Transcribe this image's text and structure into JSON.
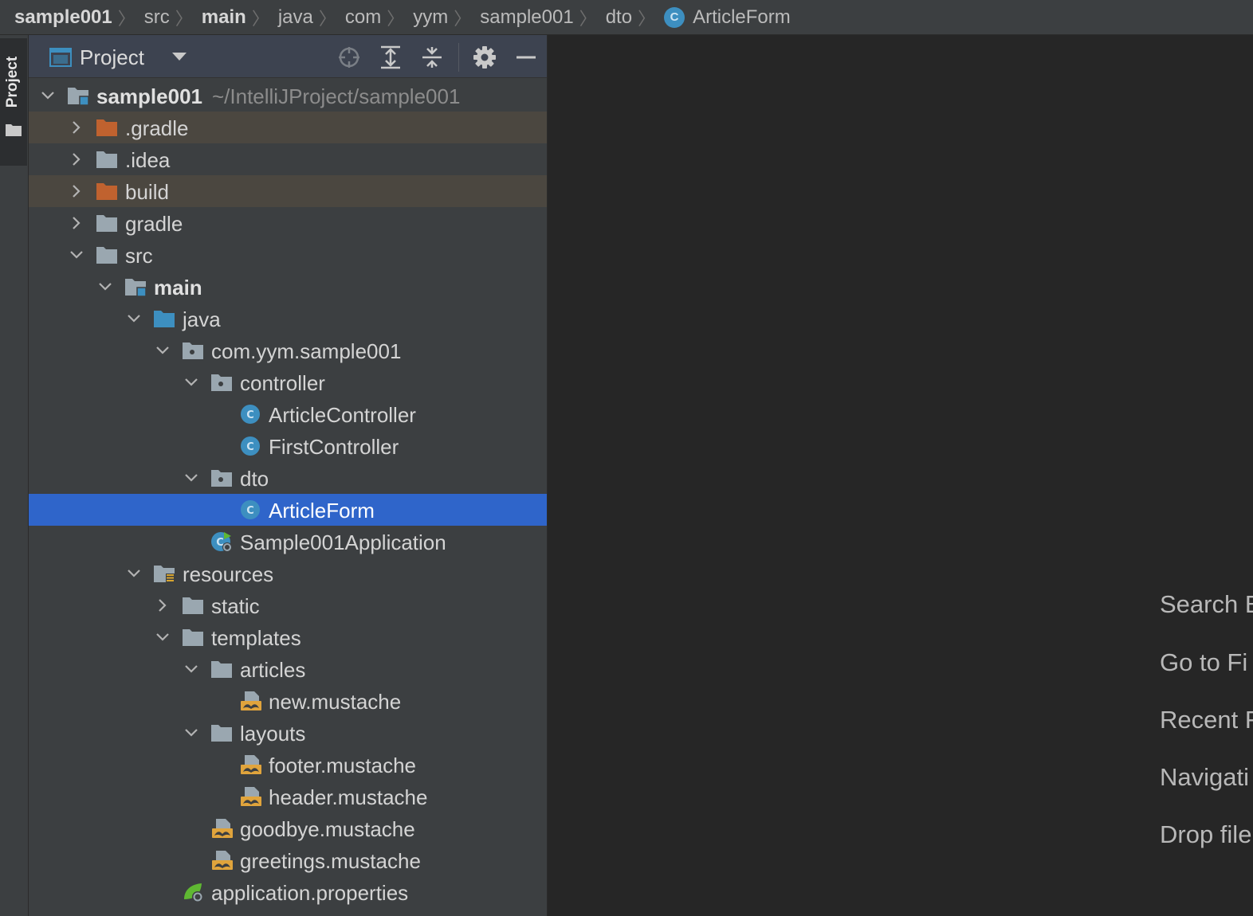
{
  "breadcrumb": {
    "items": [
      {
        "label": "sample001",
        "bold": true
      },
      {
        "label": "src"
      },
      {
        "label": "main",
        "bold": true
      },
      {
        "label": "java"
      },
      {
        "label": "com"
      },
      {
        "label": "yym"
      },
      {
        "label": "sample001"
      },
      {
        "label": "dto"
      },
      {
        "label": "ArticleForm",
        "icon": "class-icon",
        "icon_text": "C"
      }
    ]
  },
  "tool_strip": {
    "project_label": "Project",
    "folder_icon": "folder-icon"
  },
  "project_panel": {
    "title": "Project",
    "toolbar": [
      "locate-icon",
      "expand-all-icon",
      "collapse-all-icon",
      "gear-icon",
      "minimize-icon"
    ]
  },
  "tree": [
    {
      "label": "sample001",
      "sublabel": "~/IntelliJProject/sample001",
      "bold": true,
      "icon": "module-folder-icon",
      "chevron": "down"
    },
    {
      "label": ".gradle",
      "icon": "excluded-folder-icon",
      "chevron": "right",
      "state": "excluded"
    },
    {
      "label": ".idea",
      "icon": "folder-icon",
      "chevron": "right"
    },
    {
      "label": "build",
      "icon": "excluded-folder-icon",
      "chevron": "right",
      "state": "excluded"
    },
    {
      "label": "gradle",
      "icon": "folder-icon",
      "chevron": "right"
    },
    {
      "label": "src",
      "icon": "folder-icon",
      "chevron": "down"
    },
    {
      "label": "main",
      "bold": true,
      "icon": "module-folder-icon",
      "chevron": "down"
    },
    {
      "label": "java",
      "icon": "source-root-icon",
      "chevron": "down"
    },
    {
      "label": "com.yym.sample001",
      "icon": "package-icon",
      "chevron": "down"
    },
    {
      "label": "controller",
      "icon": "package-icon",
      "chevron": "down"
    },
    {
      "label": "ArticleController",
      "icon": "class-icon"
    },
    {
      "label": "FirstController",
      "icon": "class-icon"
    },
    {
      "label": "dto",
      "icon": "package-icon",
      "chevron": "down"
    },
    {
      "label": "ArticleForm",
      "icon": "class-icon",
      "state": "selected"
    },
    {
      "label": "Sample001Application",
      "icon": "spring-boot-class-icon"
    },
    {
      "label": "resources",
      "icon": "resources-root-icon",
      "chevron": "down"
    },
    {
      "label": "static",
      "icon": "folder-icon",
      "chevron": "right"
    },
    {
      "label": "templates",
      "icon": "folder-icon",
      "chevron": "down"
    },
    {
      "label": "articles",
      "icon": "folder-icon",
      "chevron": "down"
    },
    {
      "label": "new.mustache",
      "icon": "mustache-file-icon"
    },
    {
      "label": "layouts",
      "icon": "folder-icon",
      "chevron": "down"
    },
    {
      "label": "footer.mustache",
      "icon": "mustache-file-icon"
    },
    {
      "label": "header.mustache",
      "icon": "mustache-file-icon"
    },
    {
      "label": "goodbye.mustache",
      "icon": "mustache-file-icon"
    },
    {
      "label": "greetings.mustache",
      "icon": "mustache-file-icon"
    },
    {
      "label": "application.properties",
      "icon": "spring-properties-icon"
    }
  ],
  "editor_hints": [
    "Search E",
    "Go to Fi",
    "Recent F",
    "Navigati",
    "Drop file"
  ],
  "colors": {
    "selection": "#2f65ca",
    "excluded_row": "#4b4740",
    "excluded_folder": "#c0622f",
    "folder": "#9aa7b0",
    "source_folder": "#3d8fc0",
    "class_icon": "#3d8fc0",
    "mustache": "#e0a43c"
  }
}
